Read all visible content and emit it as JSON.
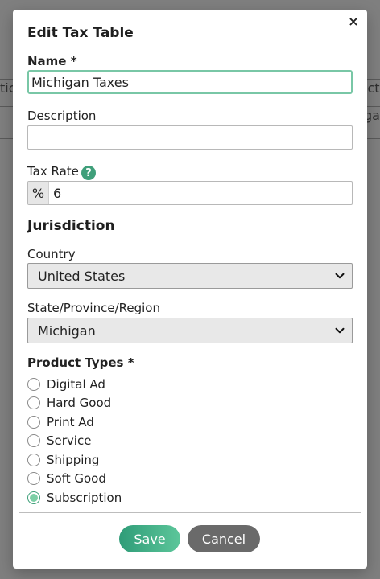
{
  "background": {
    "table_fragments": {
      "row1_left": "tic",
      "row1_right": "ict",
      "row2_left": "",
      "row2_right": "gar"
    }
  },
  "modal": {
    "title": "Edit Tax Table",
    "close_icon": "×",
    "name": {
      "label": "Name *",
      "value": "Michigan Taxes"
    },
    "description": {
      "label": "Description",
      "value": ""
    },
    "tax_rate": {
      "label": "Tax Rate",
      "help_glyph": "?",
      "prefix": "%",
      "value": "6"
    },
    "jurisdiction": {
      "title": "Jurisdiction",
      "country": {
        "label": "Country",
        "value": "United States"
      },
      "state": {
        "label": "State/Province/Region",
        "value": "Michigan"
      }
    },
    "product_types": {
      "label": "Product Types *",
      "options": [
        {
          "label": "Digital Ad",
          "checked": false
        },
        {
          "label": "Hard Good",
          "checked": false
        },
        {
          "label": "Print Ad",
          "checked": false
        },
        {
          "label": "Service",
          "checked": false
        },
        {
          "label": "Shipping",
          "checked": false
        },
        {
          "label": "Soft Good",
          "checked": false
        },
        {
          "label": "Subscription",
          "checked": true
        }
      ]
    },
    "actions": {
      "save": "Save",
      "cancel": "Cancel"
    }
  },
  "colors": {
    "accent": "#3f9f7a",
    "accent_light": "#7ccfa6",
    "overlay": "#7f7f7f",
    "cancel_bg": "#6a6a6a"
  }
}
